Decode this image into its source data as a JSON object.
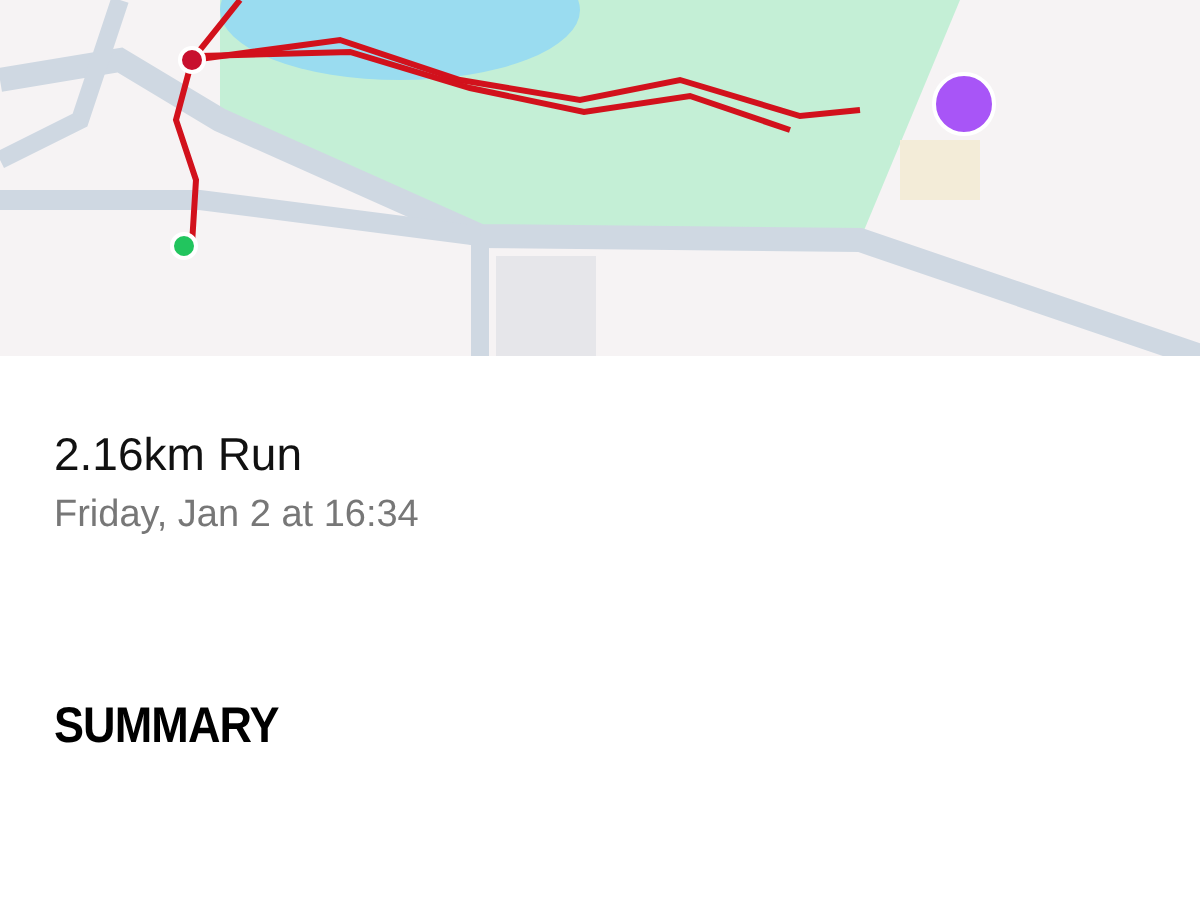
{
  "activity": {
    "title": "2.16km Run",
    "date": "Friday, Jan 2 at 16:34"
  },
  "sections": [
    {
      "heading": "SUMMARY"
    }
  ]
}
